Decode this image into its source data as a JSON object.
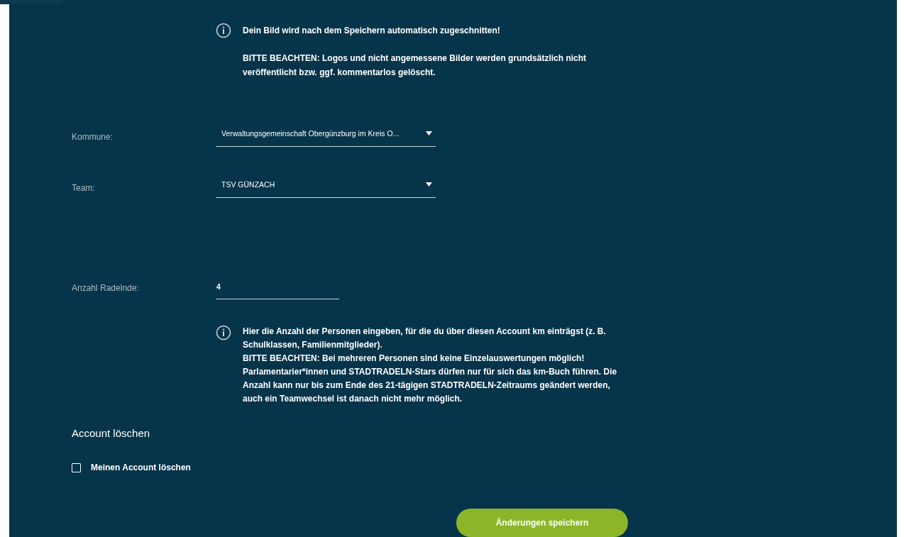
{
  "image_note": {
    "lines": [
      "Dein Bild wird nach dem Speichern automatisch zugeschnitten!",
      "BITTE BEACHTEN: Logos und nicht angemessene Bilder werden grundsätzlich nicht veröffentlicht bzw. ggf. kommentarlos gelöscht."
    ]
  },
  "fields": [
    {
      "kind": "select",
      "label": "Kommune:",
      "value": "Verwaltungsgemeinschaft Obergünzburg im Kreis O..."
    },
    {
      "kind": "select",
      "label": "Team:",
      "value": "TSV GÜNZACH"
    },
    {
      "kind": "number",
      "label": "Anzahl Radelnde:",
      "value": "4"
    }
  ],
  "riders_note": {
    "lines": [
      "Hier die Anzahl der Personen eingeben, für die du über diesen Account km einträgst (z. B. Schulklassen, Familienmitglieder).",
      "BITTE BEACHTEN: Bei mehreren Personen sind keine Einzelauswertungen möglich! Parlamentarier*innen und STADTRADELN-Stars dürfen nur für sich das km-Buch führen. Die Anzahl kann nur bis zum Ende des 21-tägigen STADTRADELN-Zeitraums geändert werden, auch ein Teamwechsel ist danach nicht mehr möglich."
    ]
  },
  "delete_section": {
    "heading": "Account löschen",
    "checkbox": {
      "label": "Meinen Account löschen",
      "checked": false
    }
  },
  "save_button": "Änderungen speichern"
}
